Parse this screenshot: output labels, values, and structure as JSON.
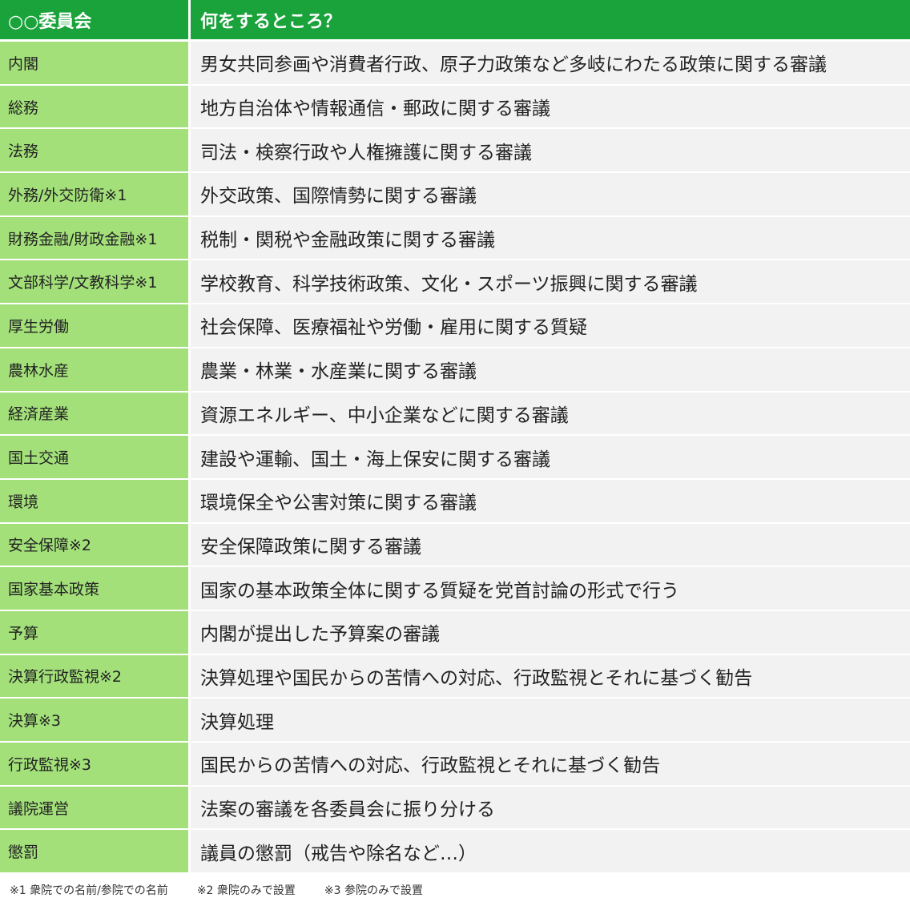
{
  "header": {
    "col1": "○○委員会",
    "col2": "何をするところ？"
  },
  "rows": [
    {
      "name": "内閣",
      "desc": "男女共同参画や消費者行政、原子力政策など多岐にわたる政策に関する審議"
    },
    {
      "name": "総務",
      "desc": "地方自治体や情報通信・郵政に関する審議"
    },
    {
      "name": "法務",
      "desc": "司法・検察行政や人権擁護に関する審議"
    },
    {
      "name": "外務/外交防衛※1",
      "desc": "外交政策、国際情勢に関する審議"
    },
    {
      "name": "財務金融/財政金融※1",
      "desc": "税制・関税や金融政策に関する審議"
    },
    {
      "name": "文部科学/文教科学※1",
      "desc": "学校教育、科学技術政策、文化・スポーツ振興に関する審議"
    },
    {
      "name": "厚生労働",
      "desc": "社会保障、医療福祉や労働・雇用に関する質疑"
    },
    {
      "name": "農林水産",
      "desc": "農業・林業・水産業に関する審議"
    },
    {
      "name": "経済産業",
      "desc": "資源エネルギー、中小企業などに関する審議"
    },
    {
      "name": "国土交通",
      "desc": "建設や運輸、国土・海上保安に関する審議"
    },
    {
      "name": "環境",
      "desc": "環境保全や公害対策に関する審議"
    },
    {
      "name": "安全保障※2",
      "desc": "安全保障政策に関する審議"
    },
    {
      "name": "国家基本政策",
      "desc": "国家の基本政策全体に関する質疑を党首討論の形式で行う"
    },
    {
      "name": "予算",
      "desc": "内閣が提出した予算案の審議"
    },
    {
      "name": "決算行政監視※2",
      "desc": "決算処理や国民からの苦情への対応、行政監視とそれに基づく勧告"
    },
    {
      "name": "決算※3",
      "desc": "決算処理"
    },
    {
      "name": "行政監視※3",
      "desc": "国民からの苦情への対応、行政監視とそれに基づく勧告"
    },
    {
      "name": "議院運営",
      "desc": "法案の審議を各委員会に振り分ける"
    },
    {
      "name": "懲罰",
      "desc": "議員の懲罰（戒告や除名など…）"
    }
  ],
  "footer": {
    "note1": "※1 衆院での名前/参院での名前",
    "note2": "※2 衆院のみで設置",
    "note3": "※3 参院のみで設置"
  },
  "colors": {
    "header_bg": "#1aa33b",
    "name_bg": "#a3e07a",
    "desc_bg": "#f2f2f2"
  }
}
